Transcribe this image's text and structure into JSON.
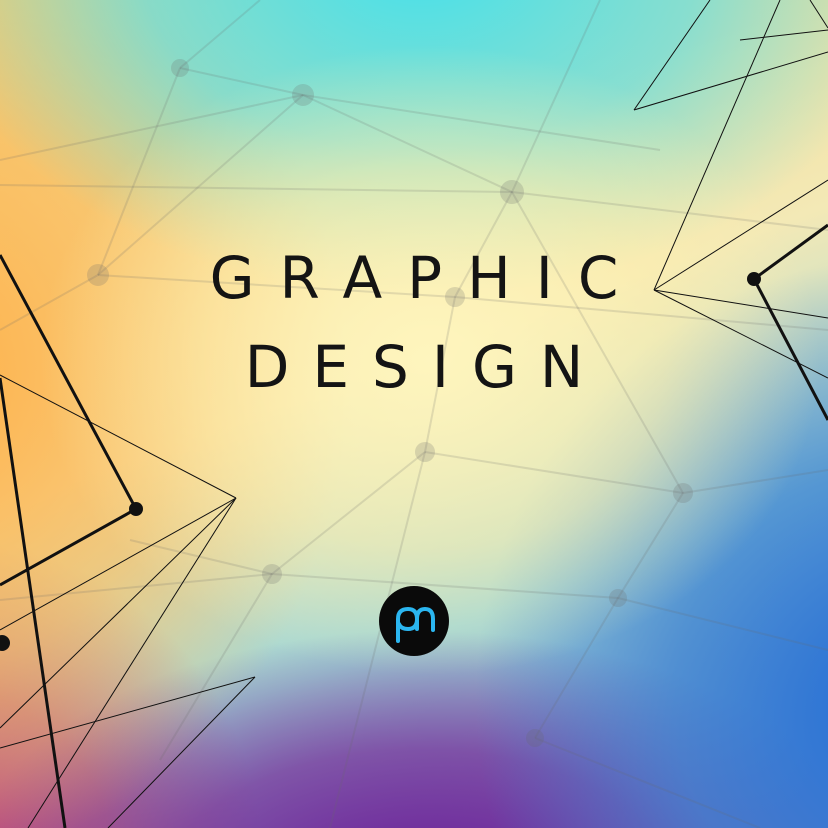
{
  "title": {
    "line_1": "GRAPHIC",
    "line_2": "DESIGN"
  },
  "logo": {
    "letters": "pn",
    "color": "#2bb6f0"
  },
  "colors": {
    "text": "#141414",
    "line": "#111111"
  }
}
